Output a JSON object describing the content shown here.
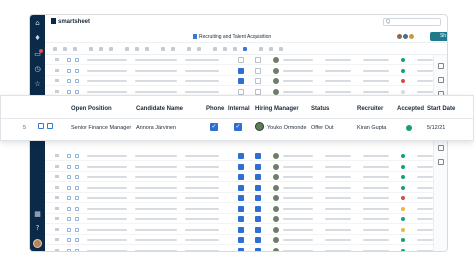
{
  "app": {
    "logo_text": "smartsheet",
    "search_placeholder": "Q"
  },
  "sheet": {
    "title": "Recruiting and Talent Acquisition",
    "share_label": "Sh"
  },
  "card": {
    "headers": {
      "open_position": "Open Position",
      "candidate_name": "Candidate Name",
      "phone": "Phone",
      "internal": "Internal",
      "hiring_manager": "Hiring Manager",
      "status": "Status",
      "recruiter": "Recruiter",
      "accepted": "Accepted",
      "start_date": "Start Date"
    },
    "row": {
      "number": "5",
      "open_position": "Senior Finance Manager",
      "candidate_name": "Annora Järvinen",
      "phone_checked": true,
      "internal_checked": true,
      "hiring_manager": "Youko Ormonde",
      "status": "Offer Out",
      "recruiter": "Kiran Gupta",
      "accepted_status_color": "#18a074",
      "start_date": "5/12/21"
    }
  },
  "grid_rows": [
    {
      "num": "1",
      "phone": false,
      "internal": false,
      "dot": "#18a074"
    },
    {
      "num": "2",
      "phone": true,
      "internal": false,
      "dot": "#18a074"
    },
    {
      "num": "3",
      "phone": true,
      "internal": false,
      "dot": "#d84a4a"
    },
    {
      "num": "4",
      "phone": false,
      "internal": false,
      "dot": "#d7dce2"
    },
    {
      "num": "6",
      "phone": true,
      "internal": true,
      "dot": "#18a074"
    },
    {
      "num": "7",
      "phone": true,
      "internal": true,
      "dot": "#18a074"
    },
    {
      "num": "8",
      "phone": true,
      "internal": true,
      "dot": "#18a074"
    },
    {
      "num": "9",
      "phone": true,
      "internal": true,
      "dot": "#18a074"
    },
    {
      "num": "10",
      "phone": true,
      "internal": true,
      "dot": "#d84a4a"
    },
    {
      "num": "11",
      "phone": true,
      "internal": true,
      "dot": "#e8b93a"
    },
    {
      "num": "12",
      "phone": true,
      "internal": true,
      "dot": "#18a074"
    },
    {
      "num": "13",
      "phone": true,
      "internal": true,
      "dot": "#e8b93a"
    },
    {
      "num": "14",
      "phone": true,
      "internal": true,
      "dot": "#18a074"
    },
    {
      "num": "15",
      "phone": true,
      "internal": true,
      "dot": "#18a074"
    }
  ],
  "colors": {
    "rail": "#0b2a4a",
    "accent": "#2f6fd1",
    "share": "#1f7a8c"
  }
}
